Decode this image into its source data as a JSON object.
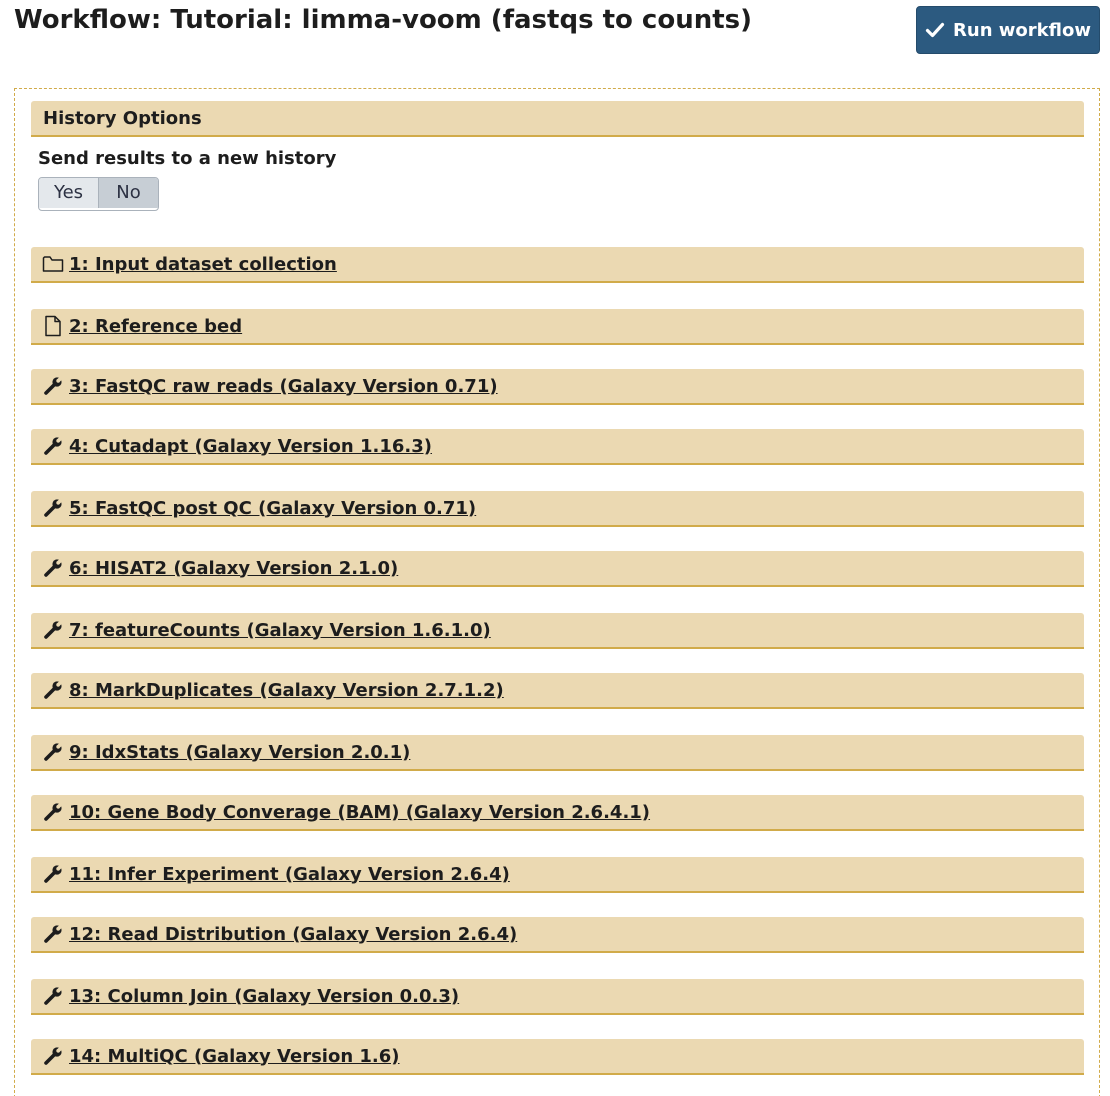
{
  "header": {
    "title": "Workflow: Tutorial: limma-voom (fastqs to counts)",
    "run_button_label": "Run workflow",
    "run_button_icon": "check-icon"
  },
  "history_options": {
    "title": "History Options",
    "send_label": "Send results to a new history",
    "toggle": {
      "yes_label": "Yes",
      "no_label": "No",
      "selected": "No"
    }
  },
  "steps": [
    {
      "label": "1: Input dataset collection",
      "icon": "folder-icon"
    },
    {
      "label": "2: Reference bed",
      "icon": "file-icon"
    },
    {
      "label": "3: FastQC raw reads (Galaxy Version 0.71)",
      "icon": "wrench-icon"
    },
    {
      "label": "4: Cutadapt (Galaxy Version 1.16.3)",
      "icon": "wrench-icon"
    },
    {
      "label": "5: FastQC post QC (Galaxy Version 0.71)",
      "icon": "wrench-icon"
    },
    {
      "label": "6: HISAT2 (Galaxy Version 2.1.0)",
      "icon": "wrench-icon"
    },
    {
      "label": "7: featureCounts (Galaxy Version 1.6.1.0)",
      "icon": "wrench-icon"
    },
    {
      "label": "8: MarkDuplicates (Galaxy Version 2.7.1.2)",
      "icon": "wrench-icon"
    },
    {
      "label": "9: IdxStats (Galaxy Version 2.0.1)",
      "icon": "wrench-icon"
    },
    {
      "label": "10: Gene Body Converage (BAM) (Galaxy Version 2.6.4.1)",
      "icon": "wrench-icon"
    },
    {
      "label": "11: Infer Experiment (Galaxy Version 2.6.4)",
      "icon": "wrench-icon"
    },
    {
      "label": "12: Read Distribution (Galaxy Version 2.6.4)",
      "icon": "wrench-icon"
    },
    {
      "label": "13: Column Join (Galaxy Version 0.0.3)",
      "icon": "wrench-icon"
    },
    {
      "label": "14: MultiQC (Galaxy Version 1.6)",
      "icon": "wrench-icon"
    }
  ],
  "colors": {
    "run_button_bg": "#2c5a80",
    "panel_bg": "#ebd9b2",
    "panel_border": "#d1ab4a"
  }
}
